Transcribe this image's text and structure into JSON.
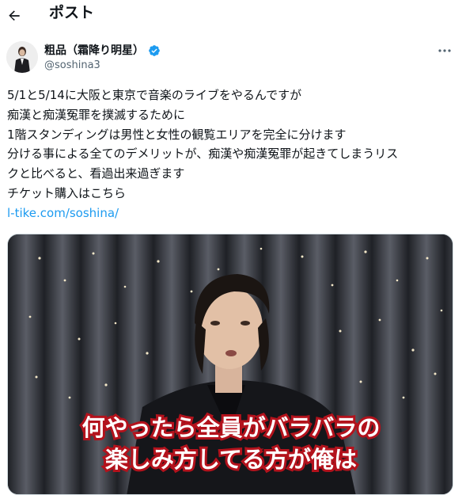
{
  "header": {
    "back_icon": "arrow-left-icon",
    "title": "ポスト"
  },
  "author": {
    "display_name": "粗品（霜降り明星）",
    "handle": "@soshina3",
    "verified": true,
    "verified_color": "#1d9bf0"
  },
  "more_icon": "ellipsis-icon",
  "tweet": {
    "lines": [
      "5/1と5/14に大阪と東京で音楽のライブをやるんですが",
      "痴漢と痴漢冤罪を撲滅するために",
      "1階スタンディングは男性と女性の観覧エリアを完全に分けます",
      "分ける事による全てのデメリットが、痴漢や痴漢冤罪が起きてしまうリス",
      "クと比べると、看過出来過ぎます",
      "チケット購入はこちら"
    ],
    "link": "l-tike.com/soshina/",
    "link_color": "#1d9bf0"
  },
  "media": {
    "caption_line1": "何やったら全員がバラバラの",
    "caption_line2": "楽しみ方してる方が俺は",
    "caption_stroke_color": "#b3121c"
  }
}
